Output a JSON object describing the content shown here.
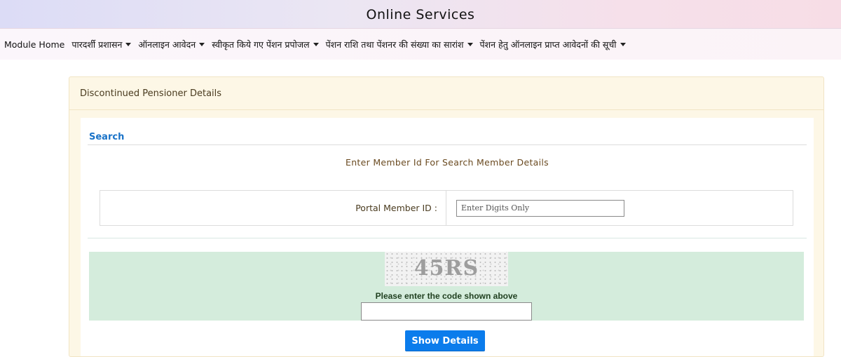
{
  "header": {
    "title": "Online Services"
  },
  "nav": {
    "items": [
      {
        "label": "Module Home",
        "dropdown": false
      },
      {
        "label": "पारदर्शी प्रशासन",
        "dropdown": true
      },
      {
        "label": "ऑनलाइन आवेदन",
        "dropdown": true
      },
      {
        "label": "स्वीकृत किये गए पेंशन प्रपोजल",
        "dropdown": true
      },
      {
        "label": "पेंशन राशि तथा पेंशनर की संख्या का सारांश",
        "dropdown": true
      },
      {
        "label": "पेंशन हेतु ऑनलाइन प्राप्त आवेदनों की सूची",
        "dropdown": true
      }
    ]
  },
  "card": {
    "title": "Discontinued Pensioner Details",
    "search_title": "Search",
    "instruction": "Enter Member Id For Search Member Details",
    "field_label": "Portal Member ID :",
    "field_placeholder": "Enter Digits Only",
    "field_value": ""
  },
  "captcha": {
    "code": "45RS",
    "prompt": "Please enter the code shown above",
    "input_value": ""
  },
  "actions": {
    "show_details_label": "Show Details"
  },
  "colors": {
    "accent_blue": "#0b7cec",
    "search_title": "#1a73c8",
    "captcha_panel": "#d4ecdc",
    "card_bg": "#fdf7e6"
  }
}
